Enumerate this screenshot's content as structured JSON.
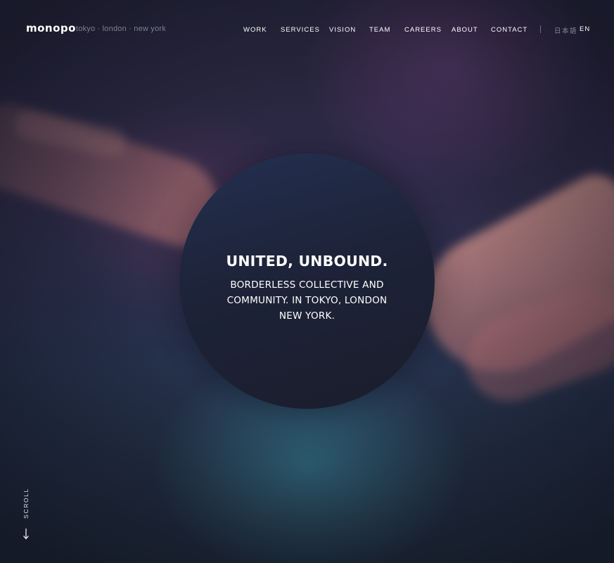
{
  "brand": {
    "logo": "monopo",
    "locations": "tokyo · london · new york"
  },
  "nav": {
    "items": [
      {
        "label": "WORK"
      },
      {
        "label": "SERVICES"
      },
      {
        "label": "VISION"
      },
      {
        "label": "TEAM"
      },
      {
        "label": "CAREERS"
      },
      {
        "label": "ABOUT"
      },
      {
        "label": "CONTACT"
      }
    ],
    "languages": [
      {
        "label": "日本語",
        "active": false
      },
      {
        "label": "EN",
        "active": true
      }
    ]
  },
  "hero": {
    "headline": "UNITED, UNBOUND.",
    "subline": [
      "BORDERLESS COLLECTIVE AND",
      "COMMUNITY. IN TOKYO, LONDON",
      "NEW YORK."
    ]
  },
  "scroll": {
    "label": "SCROLL",
    "icon": "arrow-down-icon"
  },
  "colors": {
    "circle": "#1d2339",
    "text": "#ffffff",
    "muted_text": "#8a8a9e",
    "background_accent_teal": "#30687c",
    "background_accent_purple": "#603c70"
  }
}
